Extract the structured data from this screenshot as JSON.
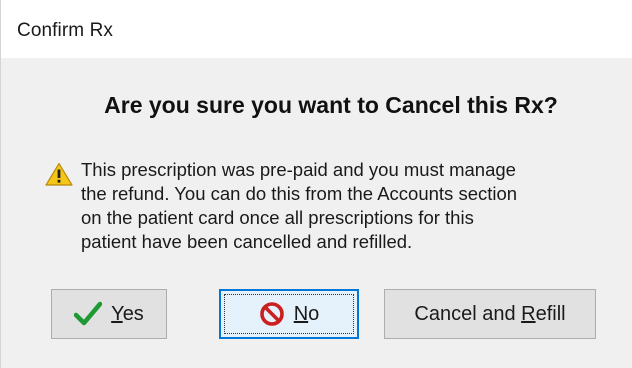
{
  "window": {
    "title": "Confirm Rx"
  },
  "dialog": {
    "heading": "Are you sure you want to Cancel this Rx?",
    "icon": "warning-icon",
    "message_lines": [
      "This prescription was pre-paid and you must manage",
      "the refund. You can do this from the Accounts section",
      "on the patient card once all prescriptions for this",
      "patient have been cancelled and refilled."
    ]
  },
  "buttons": {
    "yes": {
      "mnemonic": "Y",
      "rest": "es",
      "icon": "checkmark-icon"
    },
    "no": {
      "mnemonic": "N",
      "rest": "o",
      "icon": "prohibited-icon",
      "focused": true
    },
    "cancel_refill": {
      "before": "Cancel and ",
      "mnemonic": "R",
      "rest": "efill"
    }
  },
  "colors": {
    "warning_yellow": "#f5c518",
    "check_green": "#1f9a32",
    "prohibited_red": "#cc1f1f",
    "focus_blue": "#0078d7"
  }
}
